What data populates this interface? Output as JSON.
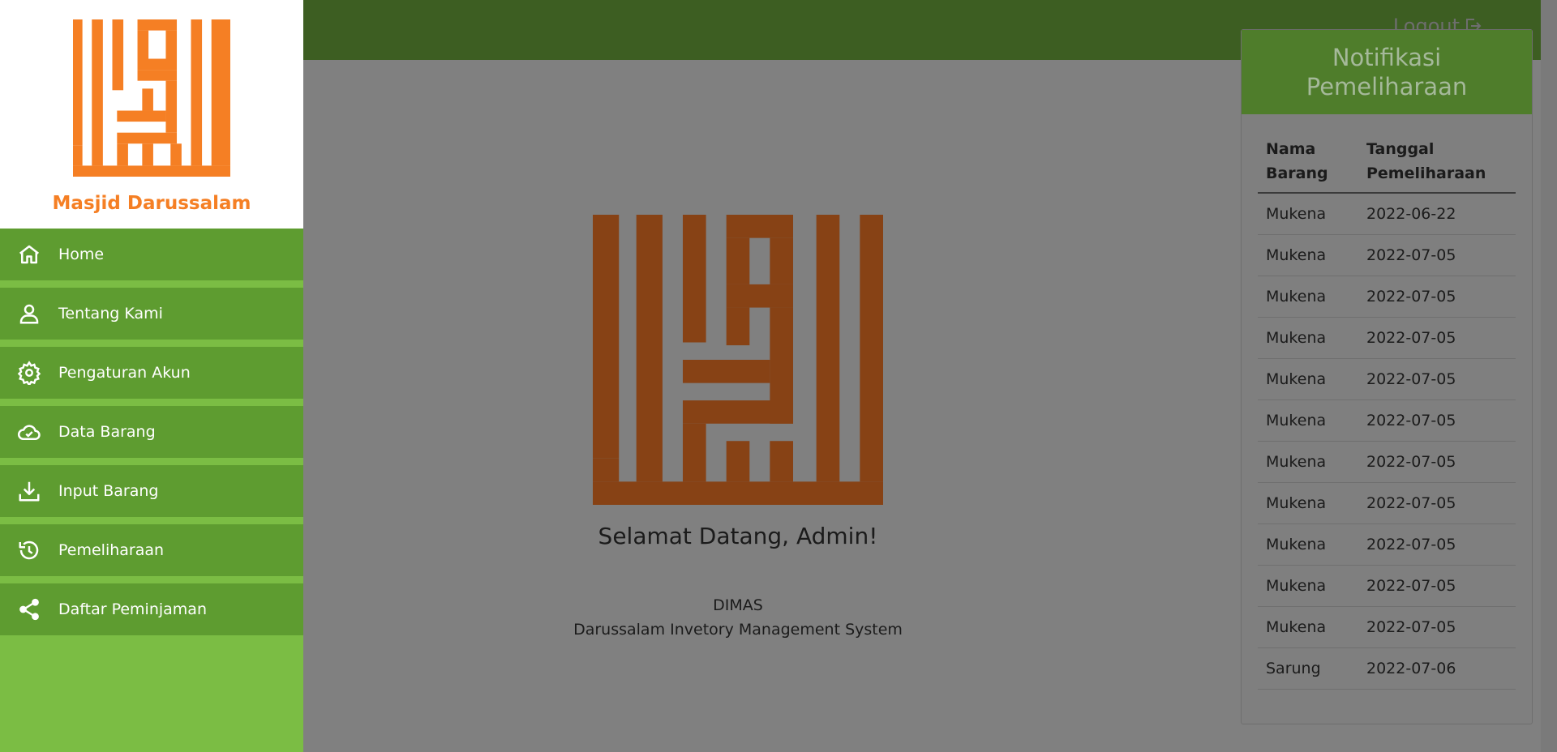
{
  "sidebar": {
    "brand_name": "Masjid Darussalam",
    "items": [
      {
        "label": "Home",
        "icon": "home-icon"
      },
      {
        "label": "Tentang Kami",
        "icon": "user-icon"
      },
      {
        "label": "Pengaturan Akun",
        "icon": "gear-icon"
      },
      {
        "label": "Data Barang",
        "icon": "cloud-check-icon"
      },
      {
        "label": "Input Barang",
        "icon": "download-icon"
      },
      {
        "label": "Pemeliharaan",
        "icon": "history-icon"
      },
      {
        "label": "Daftar Peminjaman",
        "icon": "share-icon"
      }
    ]
  },
  "topbar": {
    "logout_label": "Logout"
  },
  "main": {
    "welcome": "Selamat Datang, Admin!",
    "app_name": "DIMAS",
    "app_description": "Darussalam Invetory Management System"
  },
  "notifications": {
    "title": "Notifikasi Pemeliharaan",
    "columns": [
      "Nama Barang",
      "Tanggal Pemeliharaan"
    ],
    "rows": [
      [
        "Mukena",
        "2022-06-22"
      ],
      [
        "Mukena",
        "2022-07-05"
      ],
      [
        "Mukena",
        "2022-07-05"
      ],
      [
        "Mukena",
        "2022-07-05"
      ],
      [
        "Mukena",
        "2022-07-05"
      ],
      [
        "Mukena",
        "2022-07-05"
      ],
      [
        "Mukena",
        "2022-07-05"
      ],
      [
        "Mukena",
        "2022-07-05"
      ],
      [
        "Mukena",
        "2022-07-05"
      ],
      [
        "Mukena",
        "2022-07-05"
      ],
      [
        "Mukena",
        "2022-07-05"
      ],
      [
        "Sarung",
        "2022-07-06"
      ]
    ]
  },
  "colors": {
    "brand_orange": "#f57f24",
    "sidebar_item": "#5e9c30",
    "sidebar_bg": "#7bbd44",
    "topbar": "#3d5e22",
    "notif_header": "#4f7d2b"
  }
}
